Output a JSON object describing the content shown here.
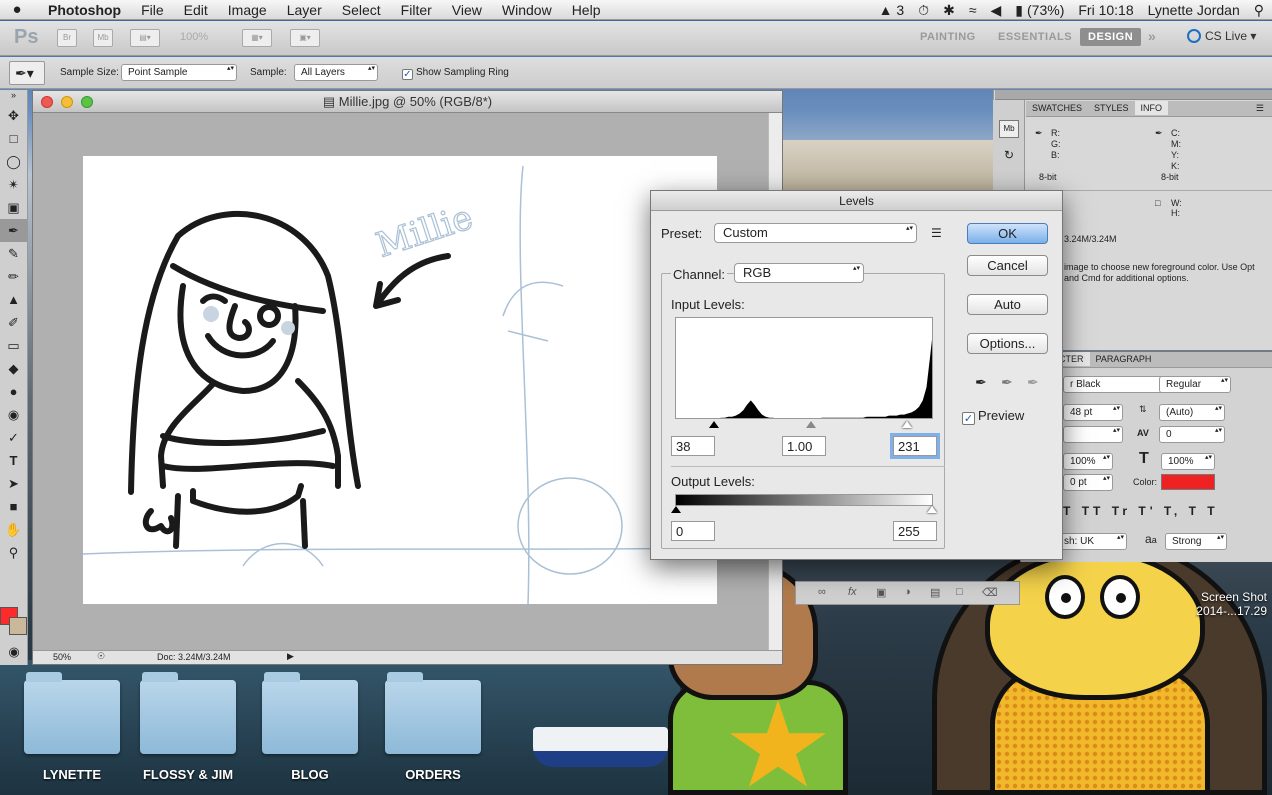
{
  "menubar": {
    "app_name": "Photoshop",
    "items": [
      "File",
      "Edit",
      "Image",
      "Layer",
      "Select",
      "Filter",
      "View",
      "Window",
      "Help"
    ],
    "status": {
      "adobe": "3",
      "battery": "(73%)",
      "clock": "Fri 10:18",
      "user": "Lynette Jordan"
    }
  },
  "appbar": {
    "logo": "Ps",
    "br": "Br",
    "mb": "Mb",
    "zoom": "100%",
    "workspaces": [
      "PAINTING",
      "ESSENTIALS",
      "DESIGN"
    ],
    "active_workspace": "DESIGN",
    "cs_live": "CS Live"
  },
  "options": {
    "sample_size_label": "Sample Size:",
    "sample_size_value": "Point Sample",
    "sample_label": "Sample:",
    "sample_value": "All Layers",
    "show_ring_label": "Show Sampling Ring",
    "show_ring_checked": true
  },
  "document": {
    "title": "Millie.jpg @ 50% (RGB/8*)",
    "zoom": "50%",
    "doc_size": "Doc: 3.24M/3.24M",
    "sketch_text": "Millie"
  },
  "levels": {
    "title": "Levels",
    "preset_label": "Preset:",
    "preset_value": "Custom",
    "channel_label": "Channel:",
    "channel_value": "RGB",
    "input_label": "Input Levels:",
    "input_black": "38",
    "input_gamma": "1.00",
    "input_white": "231",
    "output_label": "Output Levels:",
    "output_black": "0",
    "output_white": "255",
    "buttons": {
      "ok": "OK",
      "cancel": "Cancel",
      "auto": "Auto",
      "options": "Options..."
    },
    "preview_label": "Preview",
    "preview_checked": true
  },
  "info_panel": {
    "tabs": [
      "SWATCHES",
      "STYLES",
      "INFO"
    ],
    "active_tab": "INFO",
    "rgb_labels": [
      "R:",
      "G:",
      "B:"
    ],
    "cmyk_labels": [
      "C:",
      "M:",
      "Y:",
      "K:"
    ],
    "bit_left": "8-bit",
    "bit_right": "8-bit",
    "wh_labels": [
      "W:",
      "H:"
    ],
    "doc": "3.24M/3.24M",
    "hint": "image to choose new foreground color.  Use Opt and Cmd for additional options."
  },
  "character_panel": {
    "tabs": [
      "ACTER",
      "PARAGRAPH"
    ],
    "font_family": "r Black",
    "font_style": "Regular",
    "size": "48 pt",
    "leading": "(Auto)",
    "tracking": "0",
    "vscale": "100%",
    "hscale": "100%",
    "baseline": "0 pt",
    "color_label": "Color:",
    "color": "#ee2222",
    "language": "sh: UK",
    "aa_label": "a",
    "aa_value": "Strong",
    "type_buttons": [
      "T",
      "TT",
      "Tr",
      "T'",
      "T,",
      "T",
      "T"
    ]
  },
  "desktop": {
    "folders": [
      "LYNETTE",
      "FLOSSY & JIM",
      "BLOG",
      "ORDERS"
    ],
    "screenshot_label_1": "Screen Shot",
    "screenshot_label_2": "2014-...17.29"
  },
  "histogram": [
    0,
    0,
    0,
    0,
    0,
    0,
    0,
    0,
    1,
    1,
    1,
    1,
    2,
    2,
    3,
    3,
    4,
    6,
    9,
    14,
    18,
    14,
    9,
    5,
    3,
    2,
    2,
    1,
    1,
    1,
    1,
    1,
    1,
    1,
    1,
    1,
    1,
    1,
    1,
    2,
    2,
    2,
    2,
    2,
    2,
    2,
    2,
    2,
    2,
    2,
    2,
    3,
    3,
    3,
    3,
    3,
    3,
    4,
    4,
    4,
    5,
    5,
    6,
    7,
    9,
    12,
    18,
    30,
    60,
    90
  ]
}
